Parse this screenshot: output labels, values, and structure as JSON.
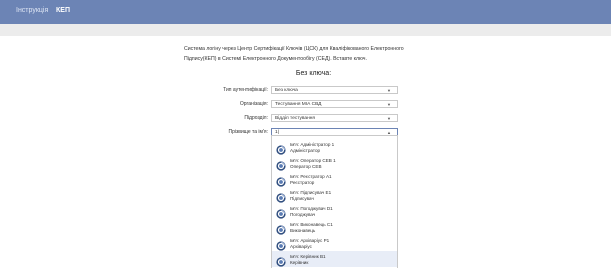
{
  "nav": {
    "items": [
      {
        "label": "Інструкція",
        "active": false
      },
      {
        "label": "КЕП",
        "active": true
      }
    ]
  },
  "intro": {
    "line1": "Система логіну через Центр Сертифікації Ключів (ЦСК) для Кваліфікованого Електронного",
    "line2": "Підпису(КЕП) в Системі Електронного Документообігу (СЕД). Вставте ключ."
  },
  "heading": "Без ключа:",
  "form": {
    "auth_type": {
      "label": "Тип аутентифікації:",
      "value": "Без ключа"
    },
    "organization": {
      "label": "Організація:",
      "value": "Тестування МІА СВД"
    },
    "department": {
      "label": "Підрозділ:",
      "value": "Відділ тестування"
    },
    "person": {
      "label": "Прізвище та ім'я:",
      "value": "1|"
    }
  },
  "options": [
    {
      "line1": "Ім'я: Адміністратор 1",
      "line2": "Адміністратор"
    },
    {
      "line1": "Ім'я: Оператор СЕВ 1",
      "line2": "Оператор СЕВ"
    },
    {
      "line1": "Ім'я: Реєстратор А1",
      "line2": "Реєстратор"
    },
    {
      "line1": "Ім'я: Підписувач Е1",
      "line2": "Підписувач"
    },
    {
      "line1": "Ім'я: Погоджувач D1",
      "line2": "Погоджувач"
    },
    {
      "line1": "Ім'я: Виконавець С1",
      "line2": "Виконавець"
    },
    {
      "line1": "Ім'я: Архіваріус Р1",
      "line2": "Архіваріус"
    },
    {
      "line1": "Ім'я: Керівник В1",
      "line2": "Керівник"
    }
  ],
  "highlighted_option_index": 7,
  "colors": {
    "nav_bg": "#6c84b5",
    "grey_bar": "#ececec",
    "highlight": "#e8edf7"
  },
  "icons": {
    "caret_down": "chevron-down-icon",
    "caret_up": "chevron-up-icon",
    "option": "user-avatar-icon"
  }
}
